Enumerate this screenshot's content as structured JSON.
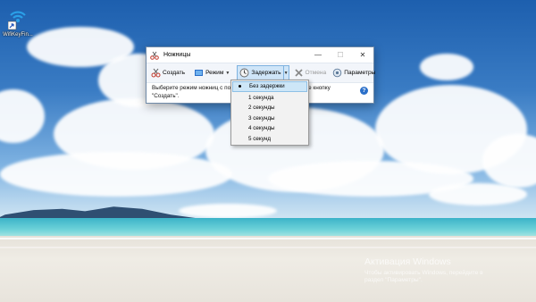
{
  "desktop": {
    "icon_label": "WifiKeyFin..."
  },
  "window": {
    "title": "Ножницы",
    "controls": {
      "minimize": "—",
      "maximize": "☐",
      "close": "✕"
    },
    "toolbar": {
      "create": "Создать",
      "mode": "Режим",
      "delay": "Задержать",
      "cancel": "Отмена",
      "options": "Параметры"
    },
    "message_line1": "Выберите режим ножниц с пом                                  нажмите кнопку",
    "message_line2": "\"Создать\".",
    "help_symbol": "?"
  },
  "delay_menu": {
    "items": [
      "Без задержки",
      "1 секунда",
      "2 секунды",
      "3 секунды",
      "4 секунды",
      "5 секунд"
    ],
    "selected": "Без задержки"
  },
  "watermark": {
    "title": "Активация Windows",
    "line1": "Чтобы активировать Windows, перейдите в",
    "line2": "раздел \"Параметры\"."
  },
  "colors": {
    "accent": "#2a6fc9",
    "pressed_bg": "#cfe5f8",
    "menu_hover": "#cde6f7"
  }
}
